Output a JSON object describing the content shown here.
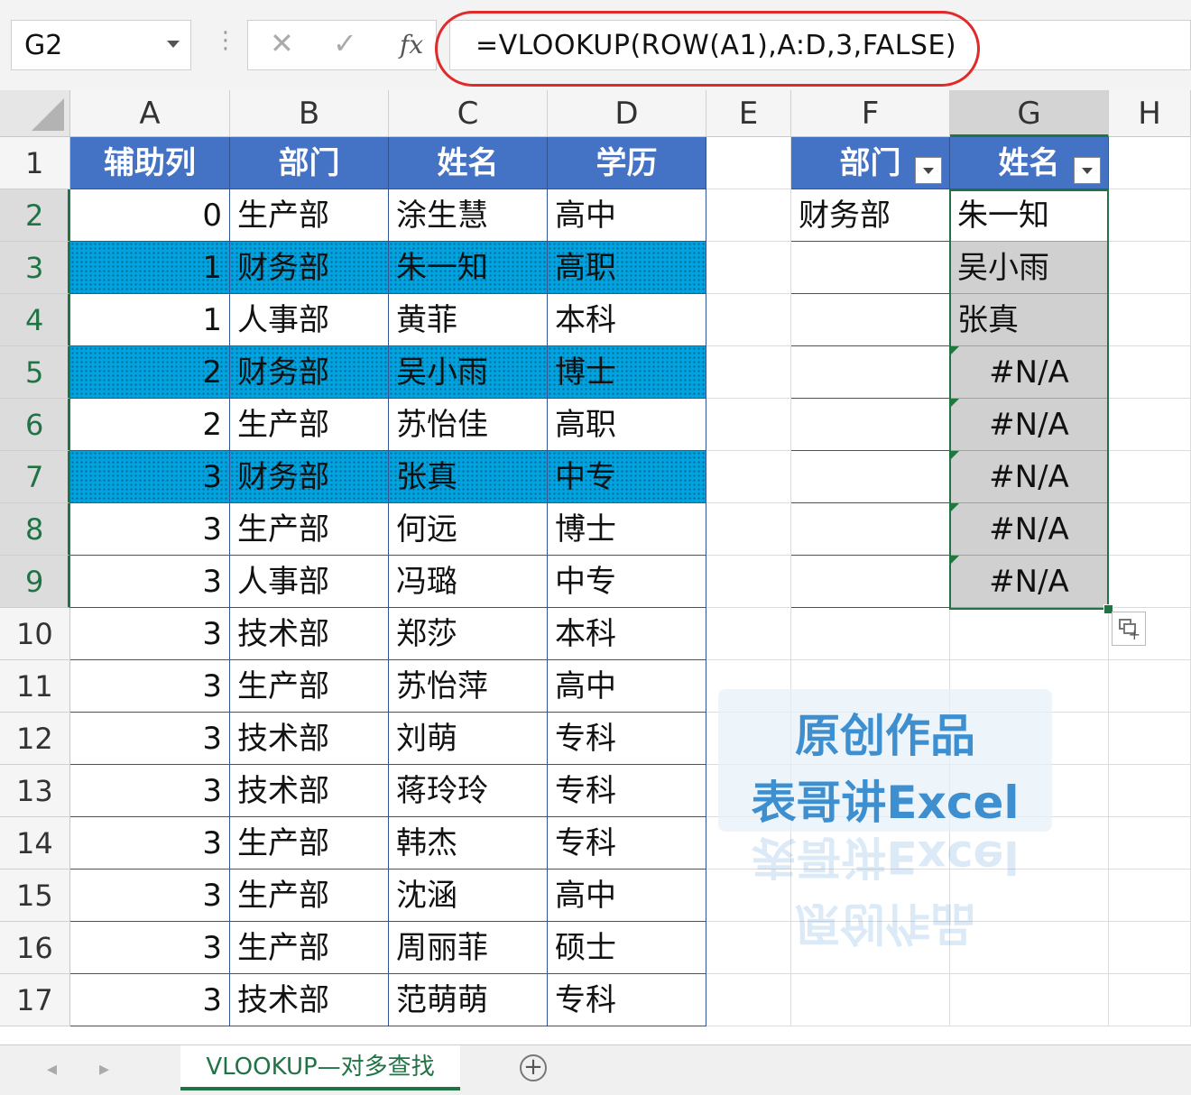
{
  "name_box": "G2",
  "formula_bar": {
    "cancel_icon": "✕",
    "enter_icon": "✓",
    "fx_label": "fx",
    "formula": "=VLOOKUP(ROW(A1),A:D,3,FALSE)"
  },
  "columns": [
    "A",
    "B",
    "C",
    "D",
    "E",
    "F",
    "G",
    "H"
  ],
  "rows": [
    "1",
    "2",
    "3",
    "4",
    "5",
    "6",
    "7",
    "8",
    "9",
    "10",
    "11",
    "12",
    "13",
    "14",
    "15",
    "16",
    "17"
  ],
  "table": {
    "headers": [
      "辅助列",
      "部门",
      "姓名",
      "学历"
    ],
    "rows": [
      {
        "a": "0",
        "b": "生产部",
        "c": "涂生慧",
        "d": "高中",
        "hl": false
      },
      {
        "a": "1",
        "b": "财务部",
        "c": "朱一知",
        "d": "高职",
        "hl": true
      },
      {
        "a": "1",
        "b": "人事部",
        "c": "黄菲",
        "d": "本科",
        "hl": false
      },
      {
        "a": "2",
        "b": "财务部",
        "c": "吴小雨",
        "d": "博士",
        "hl": true
      },
      {
        "a": "2",
        "b": "生产部",
        "c": "苏怡佳",
        "d": "高职",
        "hl": false
      },
      {
        "a": "3",
        "b": "财务部",
        "c": "张真",
        "d": "中专",
        "hl": true
      },
      {
        "a": "3",
        "b": "生产部",
        "c": "何远",
        "d": "博士",
        "hl": false
      },
      {
        "a": "3",
        "b": "人事部",
        "c": "冯璐",
        "d": "中专",
        "hl": false
      },
      {
        "a": "3",
        "b": "技术部",
        "c": "郑莎",
        "d": "本科",
        "hl": false
      },
      {
        "a": "3",
        "b": "生产部",
        "c": "苏怡萍",
        "d": "高中",
        "hl": false
      },
      {
        "a": "3",
        "b": "技术部",
        "c": "刘萌",
        "d": "专科",
        "hl": false
      },
      {
        "a": "3",
        "b": "技术部",
        "c": "蒋玲玲",
        "d": "专科",
        "hl": false
      },
      {
        "a": "3",
        "b": "生产部",
        "c": "韩杰",
        "d": "专科",
        "hl": false
      },
      {
        "a": "3",
        "b": "生产部",
        "c": "沈涵",
        "d": "高中",
        "hl": false
      },
      {
        "a": "3",
        "b": "生产部",
        "c": "周丽菲",
        "d": "硕士",
        "hl": false
      },
      {
        "a": "3",
        "b": "技术部",
        "c": "范萌萌",
        "d": "专科",
        "hl": false
      }
    ]
  },
  "lookup": {
    "headers": [
      "部门",
      "姓名"
    ],
    "dept": "财务部",
    "results": [
      "朱一知",
      "吴小雨",
      "张真",
      "#N/A",
      "#N/A",
      "#N/A",
      "#N/A",
      "#N/A"
    ]
  },
  "watermark": {
    "line1": "原创作品",
    "line2": "表哥讲Excel"
  },
  "sheet_tab": "VLOOKUP—对多查找",
  "add_sheet_icon": "+",
  "colors": {
    "header_blue": "#4472c4",
    "highlight": "#00a3e0",
    "accent_green": "#217346"
  }
}
